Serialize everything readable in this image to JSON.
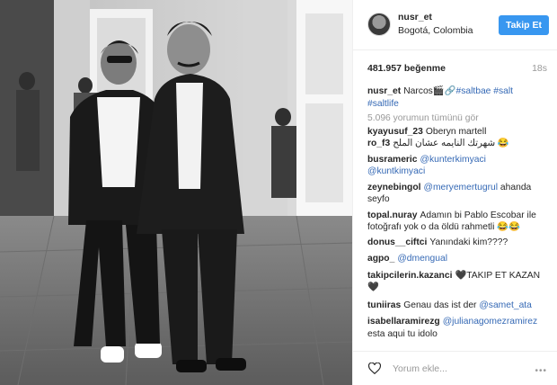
{
  "post": {
    "header": {
      "username": "nusr_et",
      "location": "Bogotá, Colombia",
      "follow_label": "Takip Et"
    },
    "likes": "481.957 beğenme",
    "time": "18s",
    "caption": {
      "username": "nusr_et",
      "text": "Narcos🎬🔗",
      "tags": [
        "#saltbae",
        "#salt",
        "#saltlife"
      ]
    },
    "view_all_comments": "5.096 yorumun tümünü gör",
    "comments": [
      {
        "username": "kyayusuf_23",
        "text": "Oberyn martell"
      },
      {
        "username": "ro_f3",
        "text": "شهرتك النايمه عشان الملح 😂"
      },
      {
        "username": "busrameric",
        "mention": "@kunterkimyaci",
        "text": ""
      },
      {
        "username": "",
        "mention": "@kuntkimyaci",
        "text": ""
      },
      {
        "username": "zeynebingol",
        "mention": "@meryemertugrul",
        "text": " ahanda seyfo"
      },
      {
        "username": "topal.nuray",
        "text": "Adamın bi Pablo Escobar ile fotoğrafı yok o da öldü rahmetli 😂😂"
      },
      {
        "username": "donus__ciftci",
        "text": "Yanındaki kim????"
      },
      {
        "username": "agpo_",
        "mention": "@dmengual",
        "text": ""
      },
      {
        "username": "takipcilerin.kazanci",
        "text": "🖤TAKIP ET KAZAN 🖤"
      },
      {
        "username": "tuniiras",
        "text": "Genau das ist der ",
        "mention2": "@samet_ata"
      },
      {
        "username": "isabellaramirezg",
        "mention": "@julianagomezramirez",
        "text": " esta aqui tu idolo"
      }
    ],
    "footer": {
      "placeholder": "Yorum ekle...",
      "more_label": "•••"
    }
  },
  "icons": {
    "heart": "heart-outline-icon",
    "more": "more-options-icon"
  },
  "colors": {
    "follow_button": "#3897f0",
    "mention": "#3569b5",
    "muted": "#999999"
  }
}
